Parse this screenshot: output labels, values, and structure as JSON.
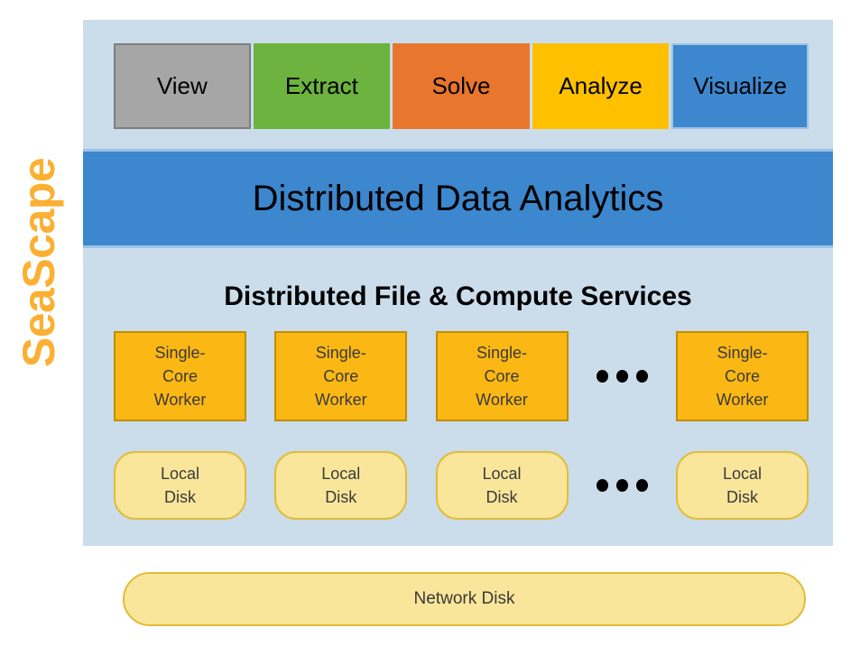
{
  "brand": {
    "label": "SeaScape",
    "color": "#FBB034"
  },
  "platform": {
    "background_color": "#CBDCEA"
  },
  "app_row": {
    "boxes": [
      {
        "label": "View",
        "fill": "#A6A6A6",
        "border": "#7F7F7F",
        "text_color": "#000000"
      },
      {
        "label": "Extract",
        "fill": "#6CB33F",
        "border": "#6CB33F",
        "text_color": "#000000"
      },
      {
        "label": "Solve",
        "fill": "#E8762C",
        "border": "#E8762C",
        "text_color": "#000000"
      },
      {
        "label": "Analyze",
        "fill": "#FFC000",
        "border": "#FFC000",
        "text_color": "#000000"
      },
      {
        "label": "Visualize",
        "fill": "#3C87CD",
        "border": "#9DC3E6",
        "text_color": "#000000"
      }
    ]
  },
  "analytics_band": {
    "label": "Distributed Data Analytics",
    "fill": "#3C87CD",
    "border": "#9DC3E6",
    "text_color": "#000000"
  },
  "services": {
    "heading": "Distributed File & Compute Services",
    "worker_label_line1": "Single-",
    "worker_label_line2": "Core",
    "worker_label_line3": "Worker",
    "worker_fill": "#FBB714",
    "worker_border": "#BF8F00",
    "disk_label_line1": "Local",
    "disk_label_line2": "Disk",
    "disk_fill": "#FAE69B",
    "disk_border": "#E0BC3A",
    "worker_count_shown": 4,
    "disk_count_shown": 4,
    "ellipsis": "•••"
  },
  "network_disk": {
    "label": "Network Disk",
    "fill": "#FAE69B",
    "border": "#E0BC3A",
    "text_color": "#3A3A38"
  }
}
